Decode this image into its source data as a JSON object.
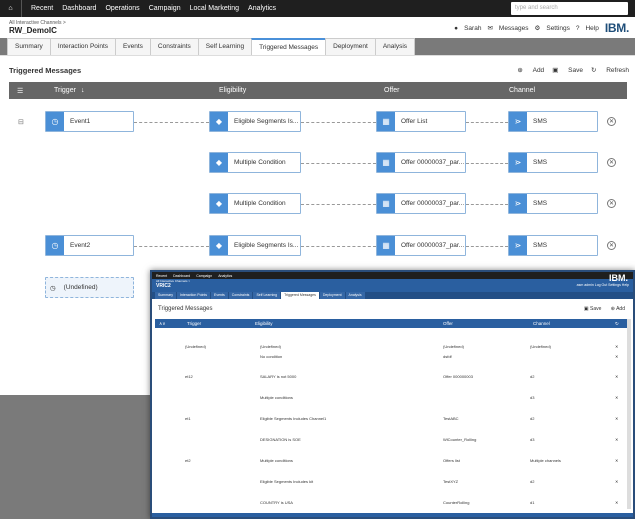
{
  "nav": {
    "items": [
      "Recent",
      "Dashboard",
      "Operations",
      "Campaign",
      "Local Marketing",
      "Analytics"
    ],
    "search_placeholder": "type and search"
  },
  "header": {
    "breadcrumb": "All Interactive Channels >",
    "title": "RW_DemoIC",
    "user": "Sarah",
    "messages": "Messages",
    "settings": "Settings",
    "help": "Help",
    "logo": "IBM."
  },
  "tabs": [
    "Summary",
    "Interaction Points",
    "Events",
    "Constraints",
    "Self Learning",
    "Triggered Messages",
    "Deployment",
    "Analysis"
  ],
  "panel": {
    "title": "Triggered Messages",
    "add": "Add",
    "save": "Save",
    "refresh": "Refresh"
  },
  "columns": {
    "trigger": "Trigger",
    "eligibility": "Eligibility",
    "offer": "Offer",
    "channel": "Channel"
  },
  "rows": [
    {
      "trigger": "Event1",
      "eligibility": "Eligible Segments Is...",
      "offer": "Offer List",
      "channel": "SMS"
    },
    {
      "trigger": "",
      "eligibility": "Multiple Condition",
      "offer": "Offer 00000037_par...",
      "channel": "SMS"
    },
    {
      "trigger": "",
      "eligibility": "Multiple Condition",
      "offer": "Offer 00000037_par...",
      "channel": "SMS"
    },
    {
      "trigger": "Event2",
      "eligibility": "Eligible Segments Is...",
      "offer": "Offer 00000037_par...",
      "channel": "SMS"
    },
    {
      "trigger": "(Undefined)",
      "eligibility": "",
      "offer": "",
      "channel": ""
    }
  ],
  "overlay": {
    "nav": [
      "Recent",
      "Dashboard",
      "Campaign",
      "Analytics"
    ],
    "breadcrumb": "All Interactive Channels >",
    "title": "VRIC2",
    "right": "asm admin   Log Out   Settings   Help",
    "logo": "IBM.",
    "tabs": [
      "Summary",
      "Interaction Points",
      "Events",
      "Constraints",
      "Self Learning",
      "Triggered Messages",
      "Deployment",
      "Analysis"
    ],
    "panel_title": "Triggered Messages",
    "save": "Save",
    "add": "Add",
    "columns": [
      "Trigger",
      "Eligibility",
      "Offer",
      "Channel"
    ],
    "rows": [
      {
        "trigger": "(Undefined)",
        "eligibility": "(Undefined)",
        "offer": "(Undefined)",
        "channel": "(Undefined)"
      },
      {
        "trigger": "",
        "eligibility": "No condition",
        "offer": "dsfdf",
        "channel": ""
      },
      {
        "trigger": "et12",
        "eligibility": "SALARY is not 5000",
        "offer": "Offer 000000003",
        "channel": "d2"
      },
      {
        "trigger": "",
        "eligibility": "Multiple conditions",
        "offer": "",
        "channel": "d3"
      },
      {
        "trigger": "et1",
        "eligibility": "Eligible Segments Includes Channel1",
        "offer": "TestABC",
        "channel": "d2"
      },
      {
        "trigger": "",
        "eligibility": "DESIGNATION is SOE",
        "offer": "WlCounter_Rolling",
        "channel": "d3"
      },
      {
        "trigger": "et2",
        "eligibility": "Multiple conditions",
        "offer": "Offers list",
        "channel": "Multiple channels"
      },
      {
        "trigger": "",
        "eligibility": "Eligible Segments Includes kit",
        "offer": "TestXYZ",
        "channel": "d2"
      },
      {
        "trigger": "",
        "eligibility": "COUNTRY is USA",
        "offer": "CounterRolling",
        "channel": "d1"
      }
    ]
  }
}
